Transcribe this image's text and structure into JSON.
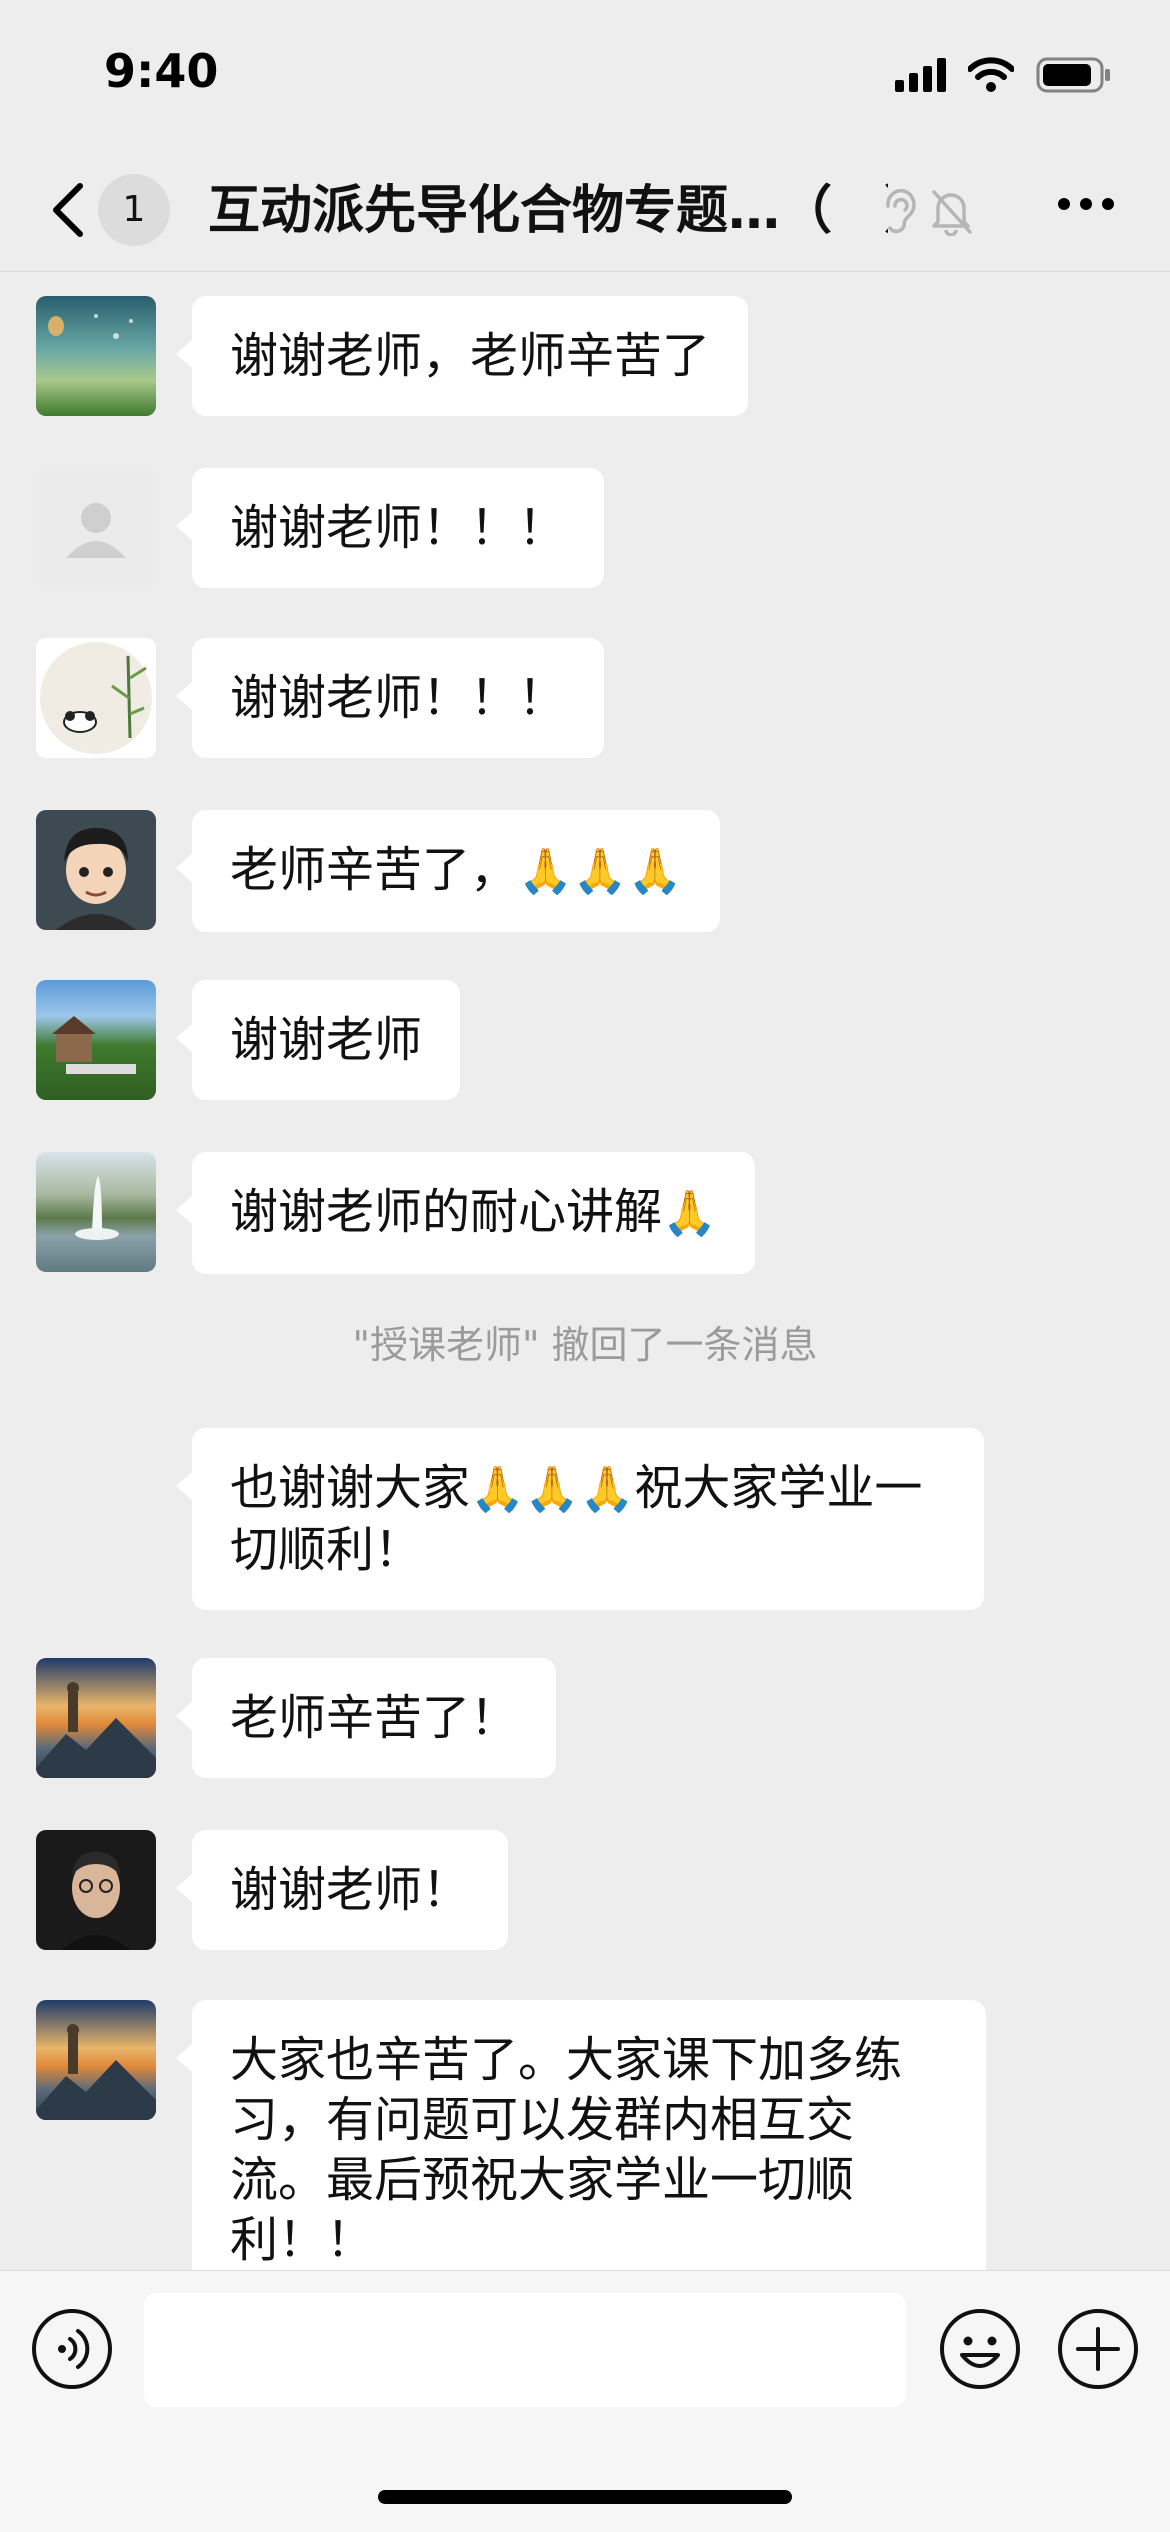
{
  "status_bar": {
    "time": "9:40"
  },
  "header": {
    "unread_count": "1",
    "title": "互动派先导化合物专题…（　）"
  },
  "messages": [
    {
      "text": "谢谢老师，老师辛苦了",
      "avatar": "landscape-avatar"
    },
    {
      "text": "谢谢老师！！！",
      "avatar": "default-avatar"
    },
    {
      "text": "谢谢老师！！！",
      "avatar": "panda-avatar"
    },
    {
      "text": "老师辛苦了，",
      "emoji": "🙏🙏🙏",
      "avatar": "cartoon-man-avatar"
    },
    {
      "text": "谢谢老师",
      "avatar": "garden-avatar"
    },
    {
      "text": "谢谢老师的耐心讲解",
      "emoji": "🙏",
      "avatar": "fountain-avatar"
    },
    {
      "text_before": "也谢谢大家",
      "emoji": "🙏🙏🙏",
      "text_after": "祝大家学业一切顺利！"
    },
    {
      "text": "老师辛苦了！",
      "avatar": "hiker-avatar"
    },
    {
      "text": "谢谢老师！",
      "avatar": "portrait-avatar"
    },
    {
      "text": "大家也辛苦了。大家课下加多练习，有问题可以发群内相互交流。最后预祝大家学业一切顺利！！",
      "avatar": "hiker-avatar"
    }
  ],
  "system_notice": "\"授课老师\" 撤回了一条消息",
  "input_bar": {
    "placeholder": ""
  },
  "colors": {
    "background": "#ededed",
    "bubble": "#ffffff",
    "notice": "#9b9b9b"
  }
}
